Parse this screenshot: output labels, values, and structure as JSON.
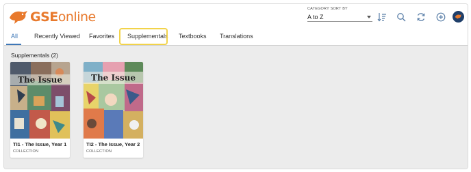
{
  "app": {
    "logo_main": "GSE",
    "logo_light": "online",
    "logo_icon": "bird-logo-icon"
  },
  "sort": {
    "label": "CATEGORY SORT BY",
    "value": "A to Z"
  },
  "toolbar": {
    "icons": [
      "sort-order-icon",
      "search-icon",
      "refresh-icon",
      "add-icon",
      "user-avatar-icon"
    ]
  },
  "tabs": [
    {
      "label": "All",
      "active": true
    },
    {
      "label": "Recently Viewed",
      "active": false
    },
    {
      "label": "Favorites",
      "active": false
    },
    {
      "label": "Supplementals",
      "active": false,
      "highlighted": true
    },
    {
      "label": "Textbooks",
      "active": false
    },
    {
      "label": "Translations",
      "active": false
    }
  ],
  "section": {
    "title": "Supplementals (2)"
  },
  "items": [
    {
      "title": "TI1 - The Issue, Year 1",
      "type": "COLLECTION",
      "cover_text": "The Issue"
    },
    {
      "title": "TI2 - The Issue, Year 2",
      "type": "COLLECTION",
      "cover_text": "The Issue"
    }
  ],
  "colors": {
    "brand_orange": "#e8792c",
    "accent_blue": "#3e77b7",
    "highlight_yellow": "#f2d34a",
    "avatar_navy": "#1f3f6a",
    "content_bg": "#ececec"
  }
}
